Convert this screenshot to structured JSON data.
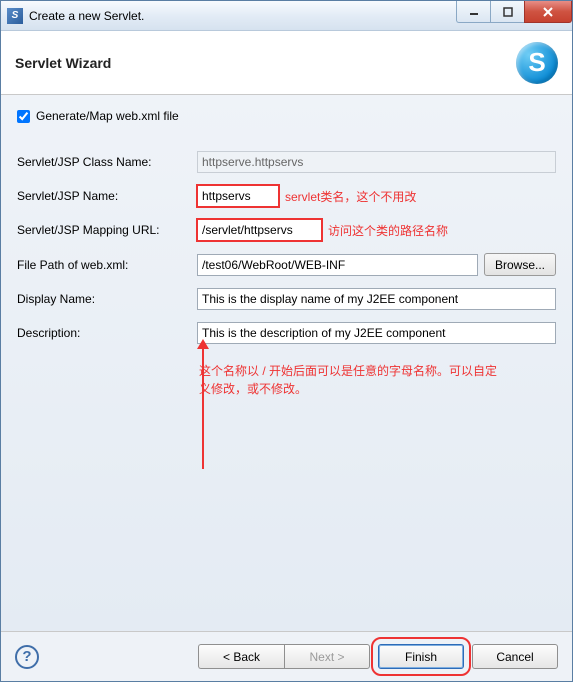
{
  "window": {
    "title": "Create a new Servlet."
  },
  "header": {
    "title": "Servlet Wizard",
    "icon_letter": "S"
  },
  "form": {
    "checkbox_label": "Generate/Map web.xml file",
    "checkbox_checked": true,
    "class_name_label": "Servlet/JSP Class Name:",
    "class_name_value": "httpserve.httpservs",
    "name_label": "Servlet/JSP Name:",
    "name_value": "httpservs",
    "mapping_label": "Servlet/JSP Mapping URL:",
    "mapping_value": "/servlet/httpservs",
    "filepath_label": "File Path of web.xml:",
    "filepath_value": "/test06/WebRoot/WEB-INF",
    "browse_label": "Browse...",
    "display_label": "Display Name:",
    "display_value": "This is the display name of my J2EE component",
    "desc_label": "Description:",
    "desc_value": "This is the description of my J2EE component"
  },
  "annotations": {
    "name_note": "servlet类名，这个不用改",
    "mapping_note": "访问这个类的路径名称",
    "bottom_note_1": "这个名称以 / 开始后面可以是任意的字母名称。可以自定",
    "bottom_note_2": "义修改，或不修改。"
  },
  "footer": {
    "back": "< Back",
    "next": "Next >",
    "finish": "Finish",
    "cancel": "Cancel"
  }
}
